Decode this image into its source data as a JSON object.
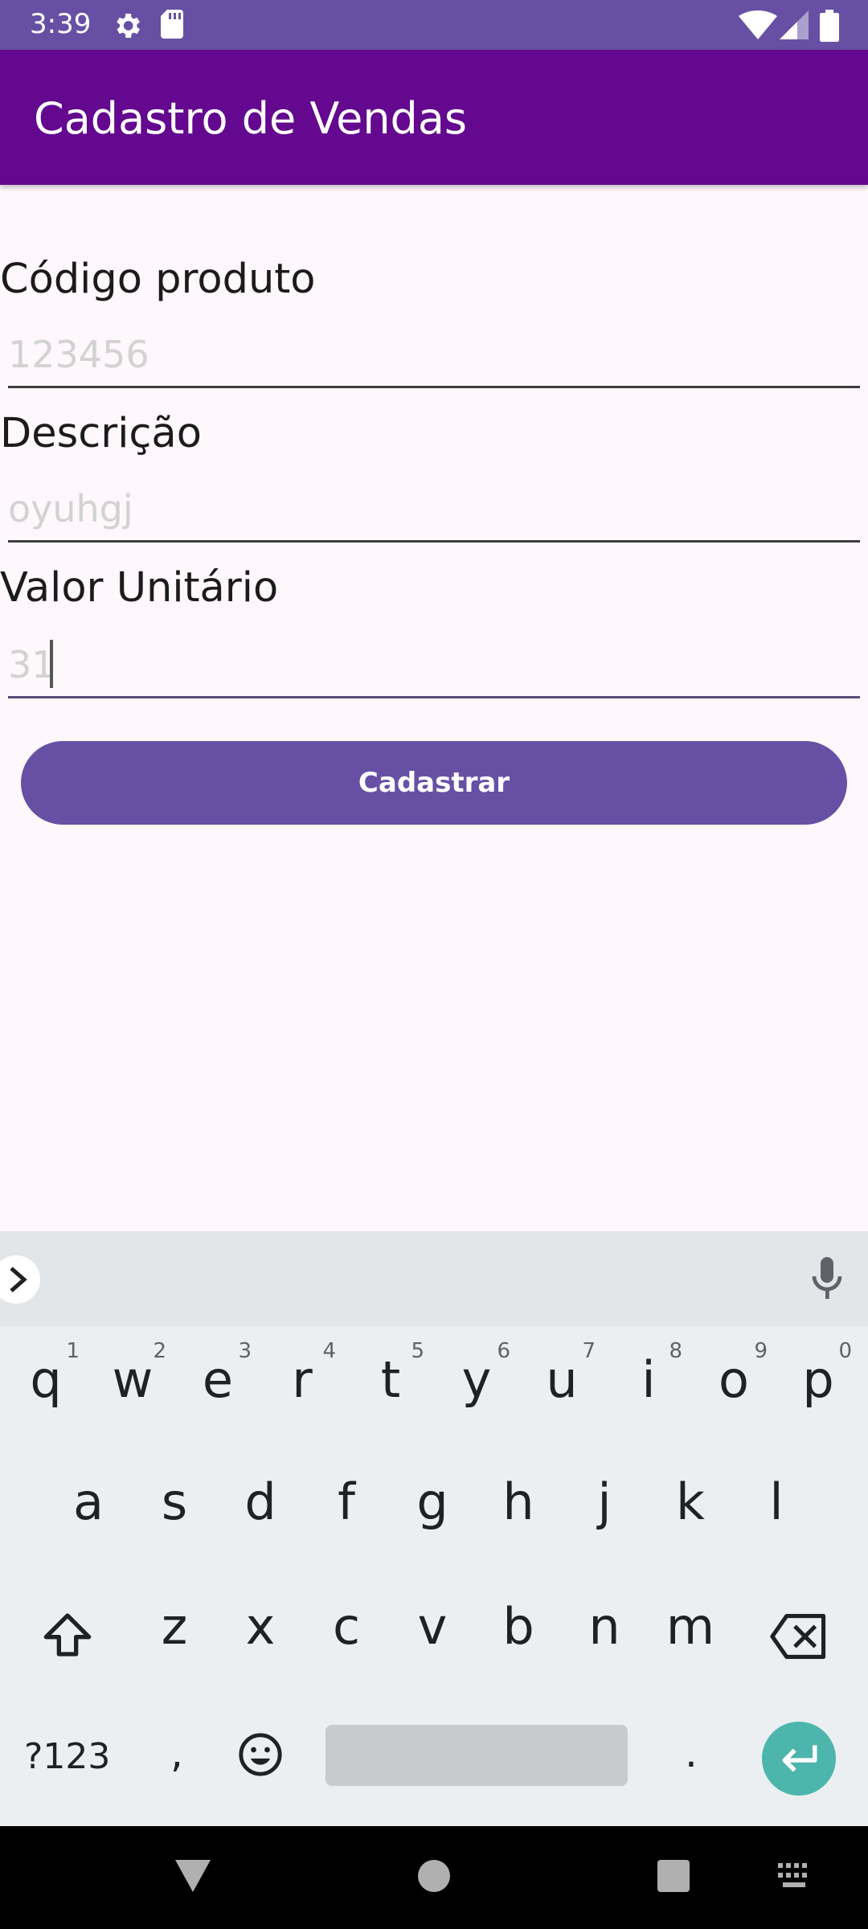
{
  "status_bar": {
    "time": "3:39",
    "icons": [
      "gear-icon",
      "sd-card-icon",
      "wifi-icon",
      "signal-icon",
      "battery-icon"
    ]
  },
  "app_bar": {
    "title": "Cadastro de Vendas",
    "color": "#63088f"
  },
  "form": {
    "code": {
      "label": "Código produto",
      "value": "123456"
    },
    "description": {
      "label": "Descrição",
      "value": "oyuhgj"
    },
    "unit_value": {
      "label": "Valor Unitário",
      "value": "31"
    },
    "submit_label": "Cadastrar",
    "accent_color": "#6750a4"
  },
  "keyboard": {
    "row1": [
      {
        "key": "q",
        "hint": "1"
      },
      {
        "key": "w",
        "hint": "2"
      },
      {
        "key": "e",
        "hint": "3"
      },
      {
        "key": "r",
        "hint": "4"
      },
      {
        "key": "t",
        "hint": "5"
      },
      {
        "key": "y",
        "hint": "6"
      },
      {
        "key": "u",
        "hint": "7"
      },
      {
        "key": "i",
        "hint": "8"
      },
      {
        "key": "o",
        "hint": "9"
      },
      {
        "key": "p",
        "hint": "0"
      }
    ],
    "row2": [
      "a",
      "s",
      "d",
      "f",
      "g",
      "h",
      "j",
      "k",
      "l"
    ],
    "row3": [
      "z",
      "x",
      "c",
      "v",
      "b",
      "n",
      "m"
    ],
    "symbols_label": "?123",
    "comma": ",",
    "period": ".",
    "enter_color": "#4db6ac"
  },
  "nav_bar": {
    "icons": [
      "back-icon",
      "home-icon",
      "recents-icon",
      "keyboard-switch-icon"
    ]
  }
}
